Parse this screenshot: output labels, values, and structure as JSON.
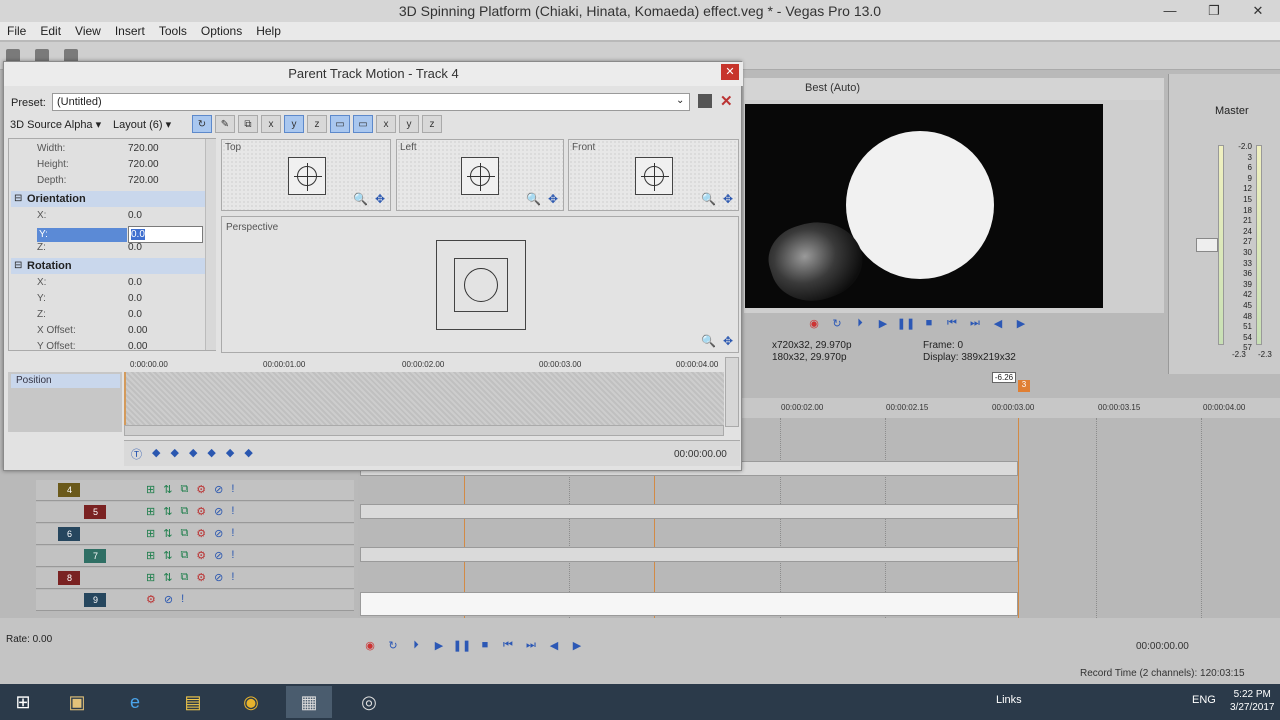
{
  "window": {
    "title": "3D Spinning Platform (Chiaki, Hinata, Komaeda) effect.veg * - Vegas Pro 13.0",
    "menu": [
      "File",
      "Edit",
      "View",
      "Insert",
      "Tools",
      "Options",
      "Help"
    ]
  },
  "preview": {
    "quality": "Best (Auto)",
    "project_info": "x720x32, 29.970p",
    "preview_info": "180x32, 29.970p",
    "frame_label": "Frame:",
    "frame_value": "0",
    "display_label": "Display:",
    "display_value": "389x219x32"
  },
  "master": {
    "label": "Master",
    "scale": [
      "-2.0",
      "3",
      "6",
      "9",
      "12",
      "15",
      "18",
      "21",
      "24",
      "27",
      "30",
      "33",
      "36",
      "39",
      "42",
      "45",
      "48",
      "51",
      "54",
      "57"
    ],
    "bottom_left": "-2.3",
    "bottom_right": "-2.3"
  },
  "dialog": {
    "title": "Parent Track Motion - Track 4",
    "preset_label": "Preset:",
    "preset_value": "(Untitled)",
    "mode": "3D Source Alpha",
    "layout": "Layout (6)",
    "props": {
      "width_label": "Width:",
      "width": "720.00",
      "height_label": "Height:",
      "height": "720.00",
      "depth_label": "Depth:",
      "depth": "720.00",
      "orientation": "Orientation",
      "ox_label": "X:",
      "ox": "0.0",
      "oy_label": "Y:",
      "oy": "0.0",
      "oz_label": "Z:",
      "oz": "0.0",
      "rotation": "Rotation",
      "rx_label": "X:",
      "rx": "0.0",
      "ry_label": "Y:",
      "ry": "0.0",
      "rz_label": "Z:",
      "rz": "0.0",
      "xoff_label": "X Offset:",
      "xoff": "0.00",
      "yoff_label": "Y Offset:",
      "yoff": "0.00"
    },
    "views": {
      "top": "Top",
      "left": "Left",
      "front": "Front",
      "perspective": "Perspective"
    },
    "timeline": {
      "ticks": [
        "0:00:00.00",
        "00:00:01.00",
        "00:00:02.00",
        "00:00:03.00",
        "00:00:04.00"
      ],
      "track_label": "Position",
      "time": "00:00:00.00"
    }
  },
  "timeline": {
    "ruler": [
      "00:00:02.00",
      "00:00:02.15",
      "00:00:03.00",
      "00:00:03.15",
      "00:00:04.00"
    ],
    "cursor_time": "-6.26",
    "region_marker": "3",
    "tracks": [
      "4",
      "5",
      "6",
      "7",
      "8",
      "9"
    ]
  },
  "status": {
    "rate": "Rate: 0.00",
    "time": "00:00:00.00",
    "record_time": "Record Time (2 channels): 120:03:15"
  },
  "taskbar": {
    "links": "Links",
    "lang": "ENG",
    "time": "5:22 PM",
    "date": "3/27/2017"
  }
}
